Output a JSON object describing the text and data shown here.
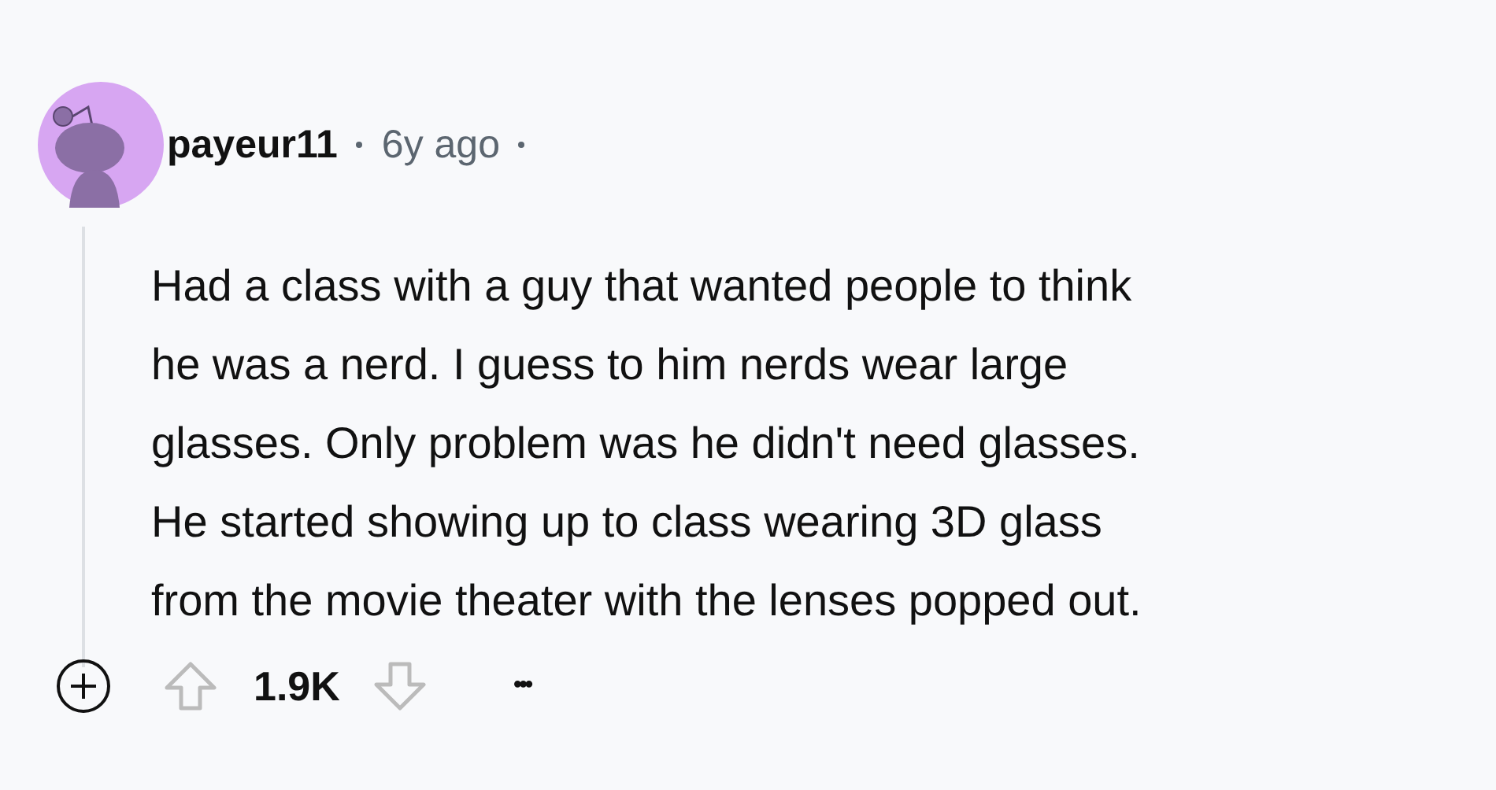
{
  "comment": {
    "author": "payeur11",
    "time": "6y ago",
    "body_lines": [
      "Had a class with a guy that wanted people to think",
      "he was a nerd. I guess to him nerds wear large",
      "glasses. Only problem was he didn't need glasses.",
      "He started showing up to class wearing 3D glass",
      "from the movie theater with the lenses popped out."
    ],
    "score": "1.9K",
    "more": "•••"
  }
}
